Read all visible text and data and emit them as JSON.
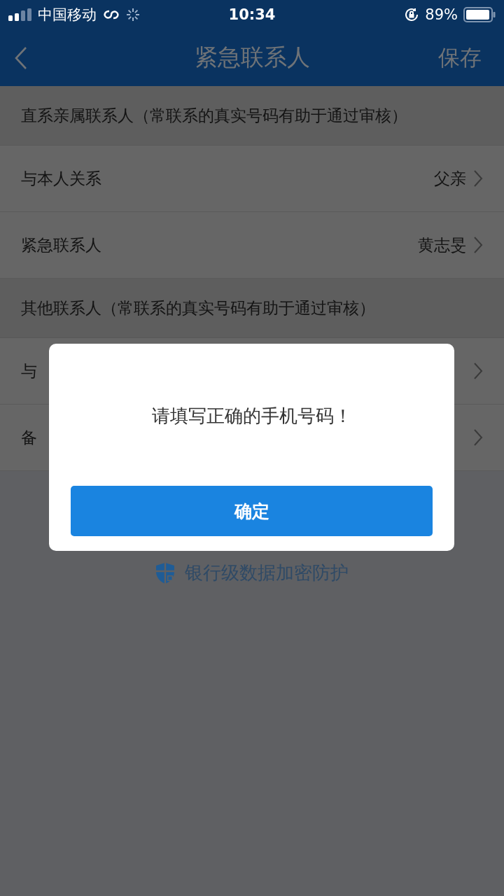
{
  "status_bar": {
    "carrier": "中国移动",
    "time": "10:34",
    "battery": "89%"
  },
  "nav": {
    "title": "紧急联系人",
    "action": "保存"
  },
  "sections": [
    {
      "header": "直系亲属联系人（常联系的真实号码有助于通过审核）",
      "rows": [
        {
          "label": "与本人关系",
          "value": "父亲"
        },
        {
          "label": "紧急联系人",
          "value": "黄志旻"
        }
      ]
    },
    {
      "header": "其他联系人（常联系的真实号码有助于通过审核）",
      "rows": [
        {
          "label": "与"
        },
        {
          "label": "备"
        }
      ]
    }
  ],
  "footer": "银行级数据加密防护",
  "dialog": {
    "message": "请填写正确的手机号码！",
    "button": "确定"
  }
}
